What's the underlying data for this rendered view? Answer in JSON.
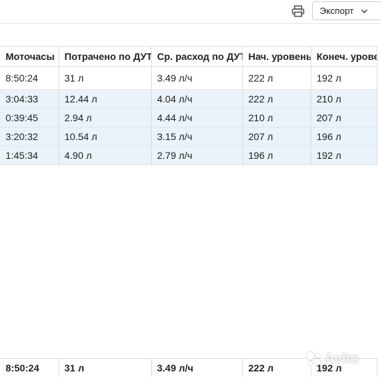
{
  "toolbar": {
    "print_icon": "printer-icon",
    "export_label": "Экспорт",
    "export_caret_icon": "chevron-down-icon"
  },
  "table": {
    "columns": [
      "Моточасы",
      "Потрачено по ДУТ",
      "Ср. расход по ДУТ",
      "Нач. уровень",
      "Конеч. уровень"
    ],
    "summary_row": [
      "8:50:24",
      "31 л",
      "3.49 л/ч",
      "222 л",
      "192 л"
    ],
    "detail_rows": [
      [
        "3:04:33",
        "12.44 л",
        "4.04 л/ч",
        "222 л",
        "210 л"
      ],
      [
        "0:39:45",
        "2.94 л",
        "4.44 л/ч",
        "210 л",
        "207 л"
      ],
      [
        "3:20:32",
        "10.54 л",
        "3.15 л/ч",
        "207 л",
        "196 л"
      ],
      [
        "1:45:34",
        "4.90 л",
        "2.79 л/ч",
        "196 л",
        "192 л"
      ]
    ],
    "totals_row": [
      "8:50:24",
      "31 л",
      "3.49 л/ч",
      "222 л",
      "192 л"
    ]
  },
  "watermark": {
    "text": "Avito"
  },
  "colors": {
    "detail_row_bg": "#eaf2fa",
    "border": "#d9dde3",
    "text": "#222222"
  }
}
